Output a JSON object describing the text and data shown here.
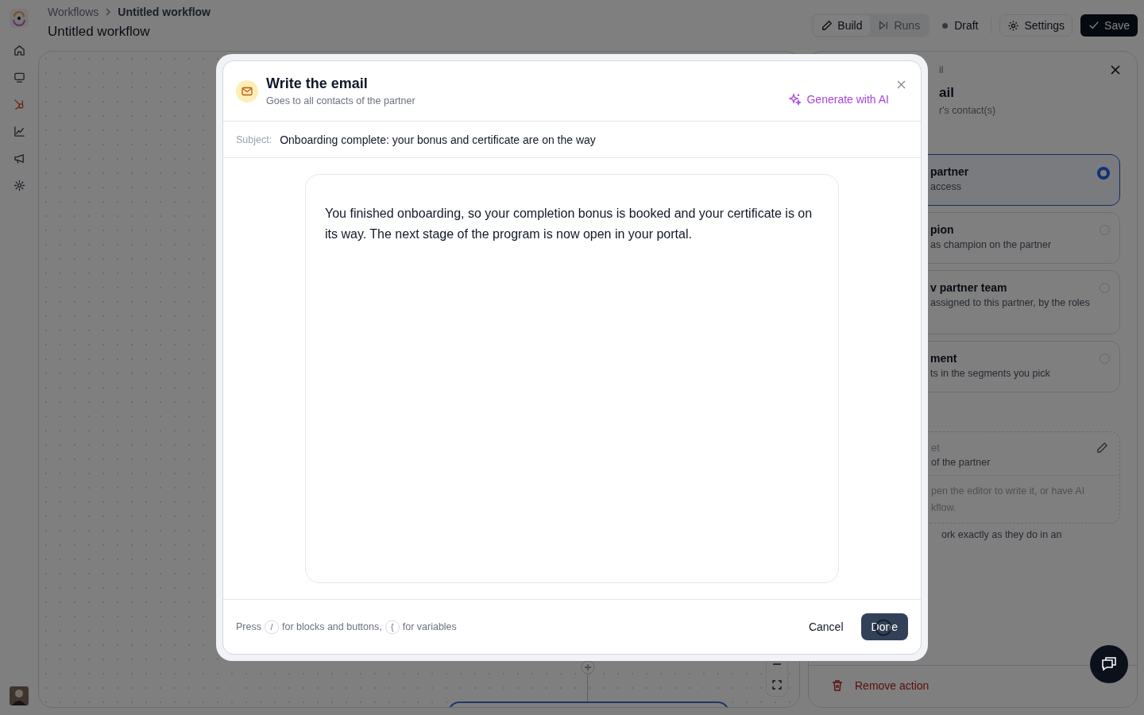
{
  "sidebar": {
    "items": [
      {
        "kind": "home",
        "selected": false
      },
      {
        "kind": "monitor",
        "selected": false
      },
      {
        "kind": "hub",
        "selected": true
      },
      {
        "kind": "chart",
        "selected": false
      },
      {
        "kind": "megaphone",
        "selected": false
      },
      {
        "kind": "gear",
        "selected": false
      }
    ]
  },
  "header": {
    "breadcrumb": [
      "Workflows",
      "Untitled workflow"
    ],
    "title": "Untitled workflow",
    "tabs": [
      {
        "label": "Build",
        "selected": true
      },
      {
        "label": "Runs",
        "selected": false
      }
    ],
    "status": "Draft",
    "settings_button": "Settings",
    "save_button": "Save"
  },
  "panel": {
    "label": "il",
    "title": "ail",
    "subtitle": "r's contact(s)",
    "options": [
      {
        "title": "partner",
        "description": "access",
        "selected": true
      },
      {
        "title": "pion",
        "description": "as champion on the partner",
        "selected": false
      },
      {
        "title": "v partner team",
        "description": "assigned to this partner, by the roles",
        "selected": false
      },
      {
        "title": "ment",
        "description": "ts in the segments you pick",
        "selected": false
      }
    ],
    "draft_card": {
      "title": "et",
      "subtitle": "of the partner",
      "body": "pen the editor to write it, or have AI",
      "body_2": "kflow."
    },
    "note": "ork exactly as they do in an",
    "remove_button": "Remove action"
  },
  "dialog": {
    "title": "Write the email",
    "subtitle": "Goes to all contacts of the partner",
    "ai_button": "Generate with AI",
    "subject_label": "Subject:",
    "subject": "Onboarding complete: your bonus and certificate are on the way",
    "body": "You finished onboarding, so your completion bonus is booked and your certificate is on its way. The next stage of the program is now open in your portal.",
    "hint": [
      {
        "kind": "text",
        "text": "Press"
      },
      {
        "kind": "key",
        "text": "/"
      },
      {
        "kind": "text",
        "text": "for blocks and buttons,"
      },
      {
        "kind": "key",
        "text": "{"
      },
      {
        "kind": "text",
        "text": "for variables"
      }
    ],
    "cancel_button": "Cancel",
    "done_button": "Done",
    "busy": true
  }
}
